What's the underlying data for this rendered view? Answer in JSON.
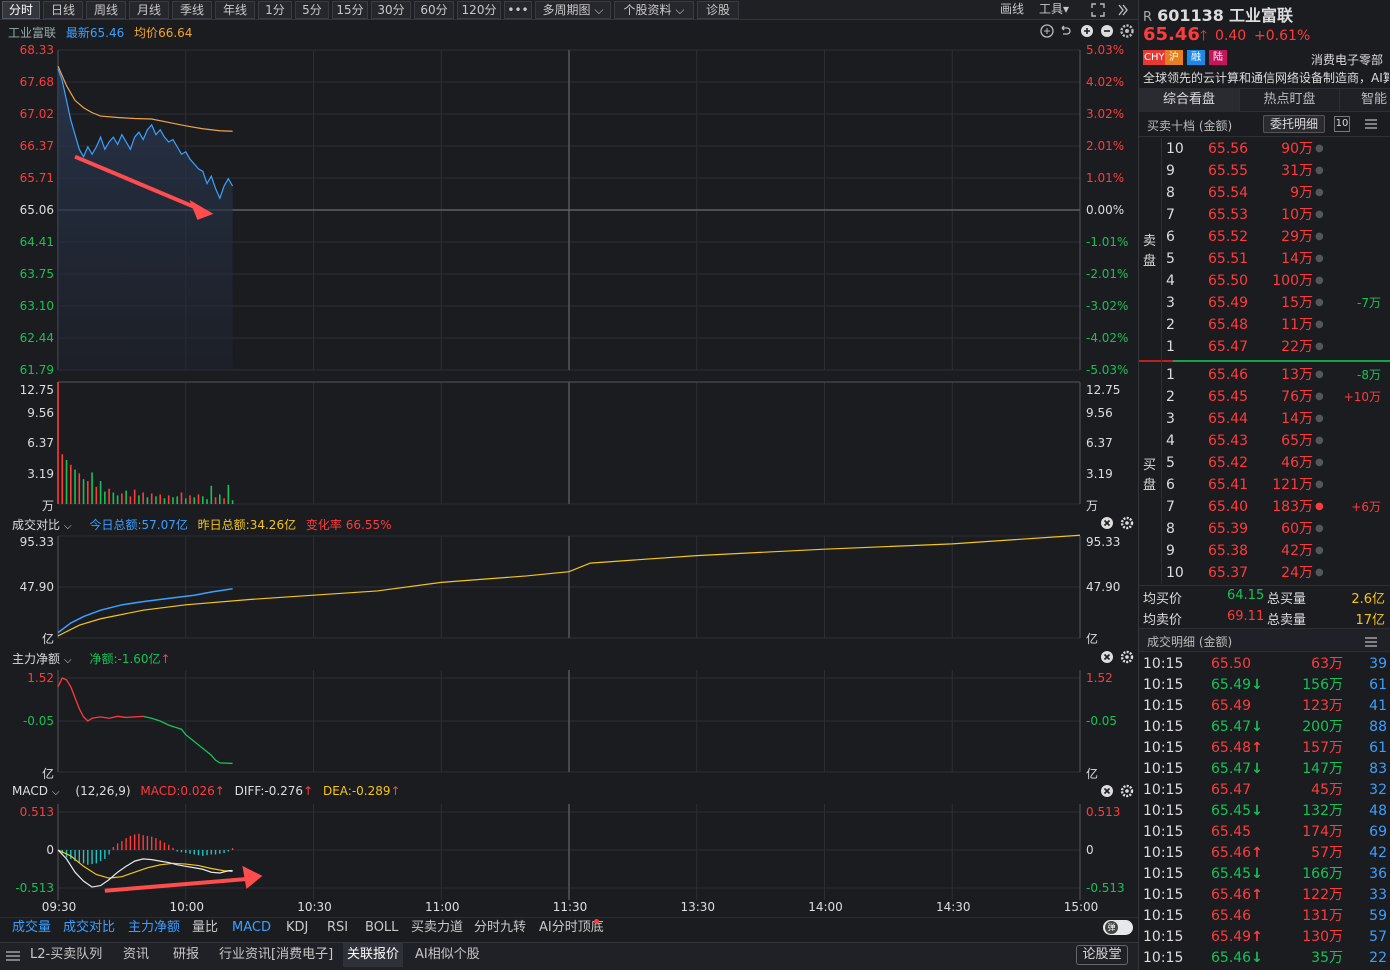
{
  "toolbar": {
    "periods": [
      "分时",
      "日线",
      "周线",
      "月线",
      "季线",
      "年线",
      "1分",
      "5分",
      "15分",
      "30分",
      "60分",
      "120分",
      "•••",
      "多周期图 ⌵",
      "个股资料 ⌵",
      "诊股"
    ],
    "draw": "画线",
    "tools": "工具",
    "tools_arrow": "▾"
  },
  "stock": {
    "prefix": "R",
    "code": "601138",
    "name": "工业富联",
    "price": "65.46",
    "change": "0.40",
    "pct": "+0.61%",
    "tags": [
      "CHY",
      "沪",
      "融",
      "陆"
    ],
    "sector": "消费电子零部",
    "desc": "全球领先的云计算和通信网络设备制造商，AI算"
  },
  "main": {
    "name": "工业富联",
    "latest_label": "最新",
    "latest": "65.46",
    "avg_label": "均价",
    "avg": "66.64",
    "y_left": [
      "68.33",
      "67.68",
      "67.02",
      "66.37",
      "65.71",
      "65.06",
      "64.41",
      "63.75",
      "63.10",
      "62.44",
      "61.79"
    ],
    "y_right": [
      "5.03%",
      "4.02%",
      "3.02%",
      "2.01%",
      "1.01%",
      "0.00%",
      "-1.01%",
      "-2.01%",
      "-3.02%",
      "-4.02%",
      "-5.03%"
    ]
  },
  "volume": {
    "y": [
      "12.75",
      "9.56",
      "6.37",
      "3.19",
      "万"
    ]
  },
  "compare": {
    "title": "成交对比",
    "today_label": "今日总额:",
    "today": "57.07亿",
    "yest_label": "昨日总额:",
    "yest": "34.26亿",
    "rate_label": "变化率",
    "rate": "66.55%",
    "y": [
      "95.33",
      "47.90",
      "亿"
    ]
  },
  "mainflow": {
    "title": "主力净额",
    "net_label": "净额:",
    "net": "-1.60亿",
    "y": [
      "1.52",
      "-0.05",
      "亿"
    ]
  },
  "macd": {
    "title": "MACD",
    "params": "(12,26,9)",
    "macd_label": "MACD:",
    "macd": "0.026",
    "diff_label": "DIFF:",
    "diff": "-0.276",
    "dea_label": "DEA:",
    "dea": "-0.289",
    "y": [
      "0.513",
      "0",
      "-0.513"
    ]
  },
  "time_axis": [
    "09:30",
    "10:00",
    "10:30",
    "11:00",
    "11:30",
    "13:30",
    "14:00",
    "14:30",
    "15:00"
  ],
  "indicator_tabs": [
    "成交量",
    "成交对比",
    "主力净额",
    "量比",
    "MACD",
    "KDJ",
    "RSI",
    "BOLL",
    "买卖力道",
    "分时九转",
    "AI分时顶底"
  ],
  "bottom_tabs": [
    "L2-买卖队列",
    "资讯",
    "研报",
    "行业资讯[消费电子]",
    "关联报价",
    "AI相似个股"
  ],
  "bottom_right": "论股堂",
  "panel_tabs": [
    "综合看盘",
    "热点盯盘",
    "智能"
  ],
  "orderbook": {
    "title": "买卖十档 (金额)",
    "detail_btn": "委托明细",
    "ten": "10",
    "sell_label": "卖盘",
    "buy_label": "买盘",
    "sells": [
      {
        "lv": "10",
        "price": "65.56",
        "vol": "90万",
        "chg": ""
      },
      {
        "lv": "9",
        "price": "65.55",
        "vol": "31万",
        "chg": ""
      },
      {
        "lv": "8",
        "price": "65.54",
        "vol": "9万",
        "chg": ""
      },
      {
        "lv": "7",
        "price": "65.53",
        "vol": "10万",
        "chg": ""
      },
      {
        "lv": "6",
        "price": "65.52",
        "vol": "29万",
        "chg": ""
      },
      {
        "lv": "5",
        "price": "65.51",
        "vol": "14万",
        "chg": ""
      },
      {
        "lv": "4",
        "price": "65.50",
        "vol": "100万",
        "chg": ""
      },
      {
        "lv": "3",
        "price": "65.49",
        "vol": "15万",
        "chg": "-7万"
      },
      {
        "lv": "2",
        "price": "65.48",
        "vol": "11万",
        "chg": ""
      },
      {
        "lv": "1",
        "price": "65.47",
        "vol": "22万",
        "chg": ""
      }
    ],
    "buys": [
      {
        "lv": "1",
        "price": "65.46",
        "vol": "13万",
        "chg": "-8万"
      },
      {
        "lv": "2",
        "price": "65.45",
        "vol": "76万",
        "chg": "+10万"
      },
      {
        "lv": "3",
        "price": "65.44",
        "vol": "14万",
        "chg": ""
      },
      {
        "lv": "4",
        "price": "65.43",
        "vol": "65万",
        "chg": ""
      },
      {
        "lv": "5",
        "price": "65.42",
        "vol": "46万",
        "chg": ""
      },
      {
        "lv": "6",
        "price": "65.41",
        "vol": "121万",
        "chg": ""
      },
      {
        "lv": "7",
        "price": "65.40",
        "vol": "183万",
        "chg": "+6万"
      },
      {
        "lv": "8",
        "price": "65.39",
        "vol": "60万",
        "chg": ""
      },
      {
        "lv": "9",
        "price": "65.38",
        "vol": "42万",
        "chg": ""
      },
      {
        "lv": "10",
        "price": "65.37",
        "vol": "24万",
        "chg": ""
      }
    ],
    "avg_buy_label": "均买价",
    "avg_buy": "64.15",
    "total_buy_label": "总买量",
    "total_buy": "2.6亿",
    "avg_sell_label": "均卖价",
    "avg_sell": "69.11",
    "total_sell_label": "总卖量",
    "total_sell": "17亿"
  },
  "trades": {
    "title": "成交明细 (金额)",
    "rows": [
      {
        "t": "10:15",
        "p": "65.50",
        "a": "",
        "v": "63万",
        "n": "39",
        "nc": "b"
      },
      {
        "t": "10:15",
        "p": "65.49",
        "a": "↓",
        "v": "156万",
        "n": "61",
        "nc": "b"
      },
      {
        "t": "10:15",
        "p": "65.49",
        "a": "",
        "v": "123万",
        "n": "41",
        "nc": "b"
      },
      {
        "t": "10:15",
        "p": "65.47",
        "a": "↓",
        "v": "200万",
        "n": "88",
        "nc": "b"
      },
      {
        "t": "10:15",
        "p": "65.48",
        "a": "↑",
        "v": "157万",
        "n": "61",
        "nc": "b"
      },
      {
        "t": "10:15",
        "p": "65.47",
        "a": "↓",
        "v": "147万",
        "n": "83",
        "nc": "b"
      },
      {
        "t": "10:15",
        "p": "65.47",
        "a": "",
        "v": "45万",
        "n": "32",
        "nc": "b"
      },
      {
        "t": "10:15",
        "p": "65.45",
        "a": "↓",
        "v": "132万",
        "n": "48",
        "nc": "b"
      },
      {
        "t": "10:15",
        "p": "65.45",
        "a": "",
        "v": "174万",
        "n": "69",
        "nc": "b"
      },
      {
        "t": "10:15",
        "p": "65.46",
        "a": "↑",
        "v": "57万",
        "n": "42",
        "nc": "b"
      },
      {
        "t": "10:15",
        "p": "65.45",
        "a": "↓",
        "v": "166万",
        "n": "36",
        "nc": "b"
      },
      {
        "t": "10:15",
        "p": "65.46",
        "a": "↑",
        "v": "122万",
        "n": "33",
        "nc": "b"
      },
      {
        "t": "10:15",
        "p": "65.46",
        "a": "",
        "v": "131万",
        "n": "59",
        "nc": "b"
      },
      {
        "t": "10:15",
        "p": "65.49",
        "a": "↑",
        "v": "130万",
        "n": "57",
        "nc": "b"
      },
      {
        "t": "10:15",
        "p": "65.46",
        "a": "↓",
        "v": "35万",
        "n": "22",
        "nc": "b"
      }
    ]
  },
  "colors": {
    "up": "#ff3b3b",
    "down": "#16c257",
    "price_line": "#3aa0ff",
    "avg_line": "#f0a24a",
    "today_line": "#3aa0ff",
    "yest_line": "#f5c518",
    "annotation": "#ff4d4d"
  },
  "icons": [
    "circle-arrow-icon",
    "undo-icon",
    "plus-circle-icon",
    "minus-circle-icon",
    "gear-icon",
    "close-circle-icon",
    "expand-icon",
    "double-chevron-icon"
  ]
}
